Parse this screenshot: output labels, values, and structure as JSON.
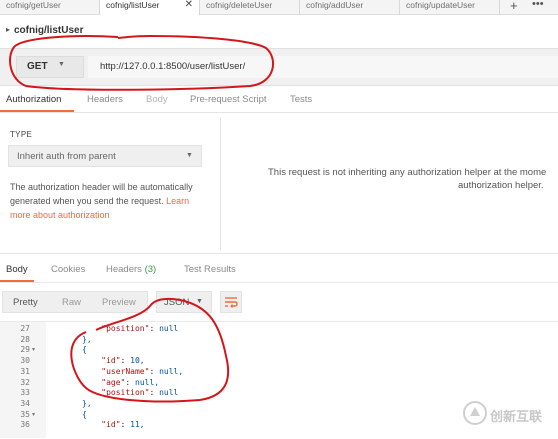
{
  "tabs": [
    {
      "label": "cofnig/getUser",
      "active": false
    },
    {
      "label": "cofnig/listUser",
      "active": true
    },
    {
      "label": "cofnig/deleteUser",
      "active": false
    },
    {
      "label": "cofnig/addUser",
      "active": false
    },
    {
      "label": "cofnig/updateUser",
      "active": false
    }
  ],
  "tab_plus": "+",
  "tab_more": "•••",
  "request_title": "cofnig/listUser",
  "method": "GET",
  "url": "http://127.0.0.1:8500/user/listUser/",
  "request_tabs": [
    "Authorization",
    "Headers",
    "Body",
    "Pre-request Script",
    "Tests"
  ],
  "auth": {
    "type_label": "TYPE",
    "select_value": "Inherit auth from parent",
    "description": "The authorization header will be automatically generated when you send the request.",
    "link": "Learn more about authorization",
    "notice_line1": "This request is not inheriting any authorization helper at the mome",
    "notice_line2": "authorization helper."
  },
  "response_tabs": [
    {
      "label": "Body"
    },
    {
      "label": "Cookies"
    },
    {
      "label": "Headers",
      "count": "(3)"
    },
    {
      "label": "Test Results"
    }
  ],
  "formats": [
    "Pretty",
    "Raw",
    "Preview"
  ],
  "format_select": "JSON",
  "code_lines": [
    {
      "num": "27",
      "fold": false,
      "key": "\"position\"",
      "sep": ": ",
      "val": "null",
      "indent": "    "
    },
    {
      "num": "28",
      "fold": false,
      "key": "",
      "sep": "",
      "val": "},",
      "indent": ""
    },
    {
      "num": "29",
      "fold": true,
      "key": "",
      "sep": "",
      "val": "{",
      "indent": ""
    },
    {
      "num": "30",
      "fold": false,
      "key": "\"id\"",
      "sep": ": ",
      "val": "10,",
      "indent": "    "
    },
    {
      "num": "31",
      "fold": false,
      "key": "\"userName\"",
      "sep": ": ",
      "val": "null,",
      "indent": "    "
    },
    {
      "num": "32",
      "fold": false,
      "key": "\"age\"",
      "sep": ": ",
      "val": "null,",
      "indent": "    "
    },
    {
      "num": "33",
      "fold": false,
      "key": "\"position\"",
      "sep": ": ",
      "val": "null",
      "indent": "    "
    },
    {
      "num": "34",
      "fold": false,
      "key": "",
      "sep": "",
      "val": "},",
      "indent": ""
    },
    {
      "num": "35",
      "fold": true,
      "key": "",
      "sep": "",
      "val": "{",
      "indent": ""
    },
    {
      "num": "36",
      "fold": false,
      "key": "\"id\"",
      "sep": ": ",
      "val": "11,",
      "indent": "    "
    }
  ],
  "watermark": "创新互联",
  "colors": {
    "accent": "#f26b3a",
    "annotation": "#d3161b",
    "count": "#3c9b4a"
  }
}
